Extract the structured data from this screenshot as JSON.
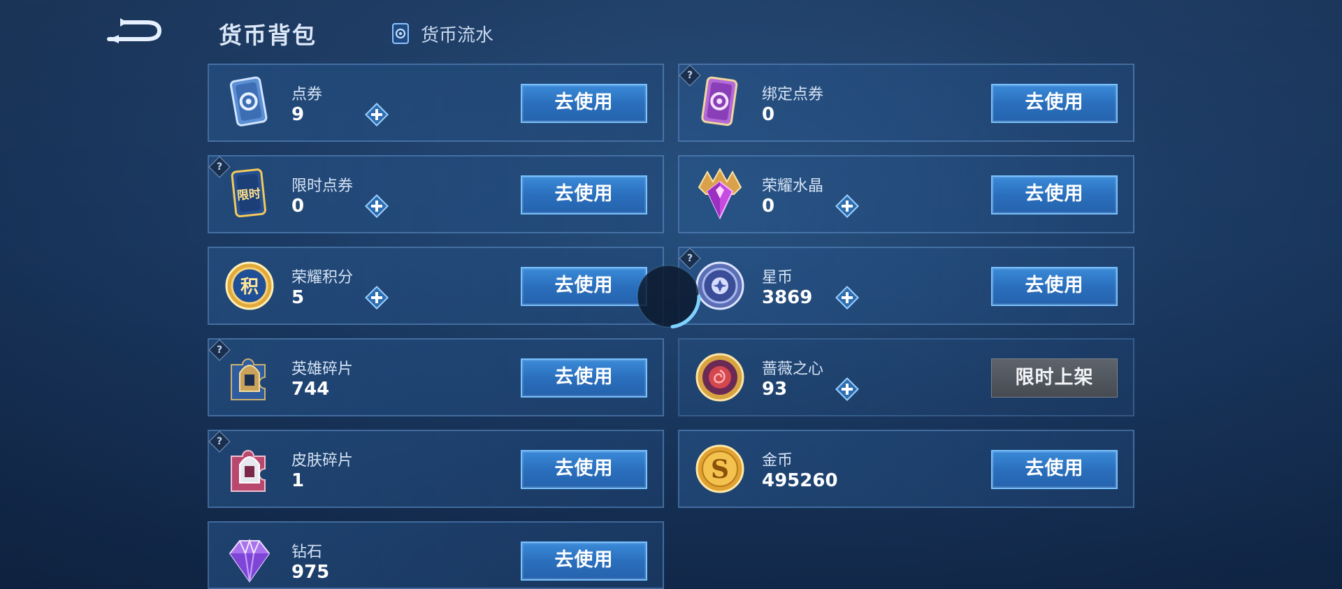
{
  "header": {
    "title": "货币背包",
    "flow_label": "货币流水"
  },
  "use_label": "去使用",
  "currencies": [
    {
      "name": "点券",
      "amount": "9",
      "help": false,
      "plus": true,
      "button": "去使用",
      "icon": "voucher-icon"
    },
    {
      "name": "绑定点券",
      "amount": "0",
      "help": true,
      "plus": false,
      "button": "去使用",
      "icon": "bound-voucher-icon"
    },
    {
      "name": "限时点券",
      "amount": "0",
      "help": true,
      "plus": true,
      "button": "去使用",
      "icon": "limited-voucher-icon",
      "icon_text": "限时"
    },
    {
      "name": "荣耀水晶",
      "amount": "0",
      "help": false,
      "plus": true,
      "button": "去使用",
      "icon": "glory-crystal-icon"
    },
    {
      "name": "荣耀积分",
      "amount": "5",
      "help": false,
      "plus": true,
      "button": "去使用",
      "icon": "glory-points-icon",
      "icon_text": "积"
    },
    {
      "name": "星币",
      "amount": "3869",
      "help": true,
      "plus": true,
      "button": "去使用",
      "icon": "star-coin-icon"
    },
    {
      "name": "英雄碎片",
      "amount": "744",
      "help": true,
      "plus": false,
      "button": "去使用",
      "icon": "hero-shard-icon"
    },
    {
      "name": "蔷薇之心",
      "amount": "93",
      "help": false,
      "plus": true,
      "button": "限时上架",
      "icon": "rose-heart-icon"
    },
    {
      "name": "皮肤碎片",
      "amount": "1",
      "help": true,
      "plus": false,
      "button": "去使用",
      "icon": "skin-shard-icon"
    },
    {
      "name": "金币",
      "amount": "495260",
      "help": false,
      "plus": false,
      "button": "去使用",
      "icon": "gold-coin-icon",
      "icon_text": "S"
    },
    {
      "name": "钻石",
      "amount": "975",
      "help": false,
      "plus": false,
      "button": "去使用",
      "icon": "diamond-icon"
    }
  ],
  "colors": {
    "button_blue": "#2a6fbd",
    "button_border": "#79c1ff",
    "limited_gray": "#50565e",
    "background": "#1b3a63"
  }
}
